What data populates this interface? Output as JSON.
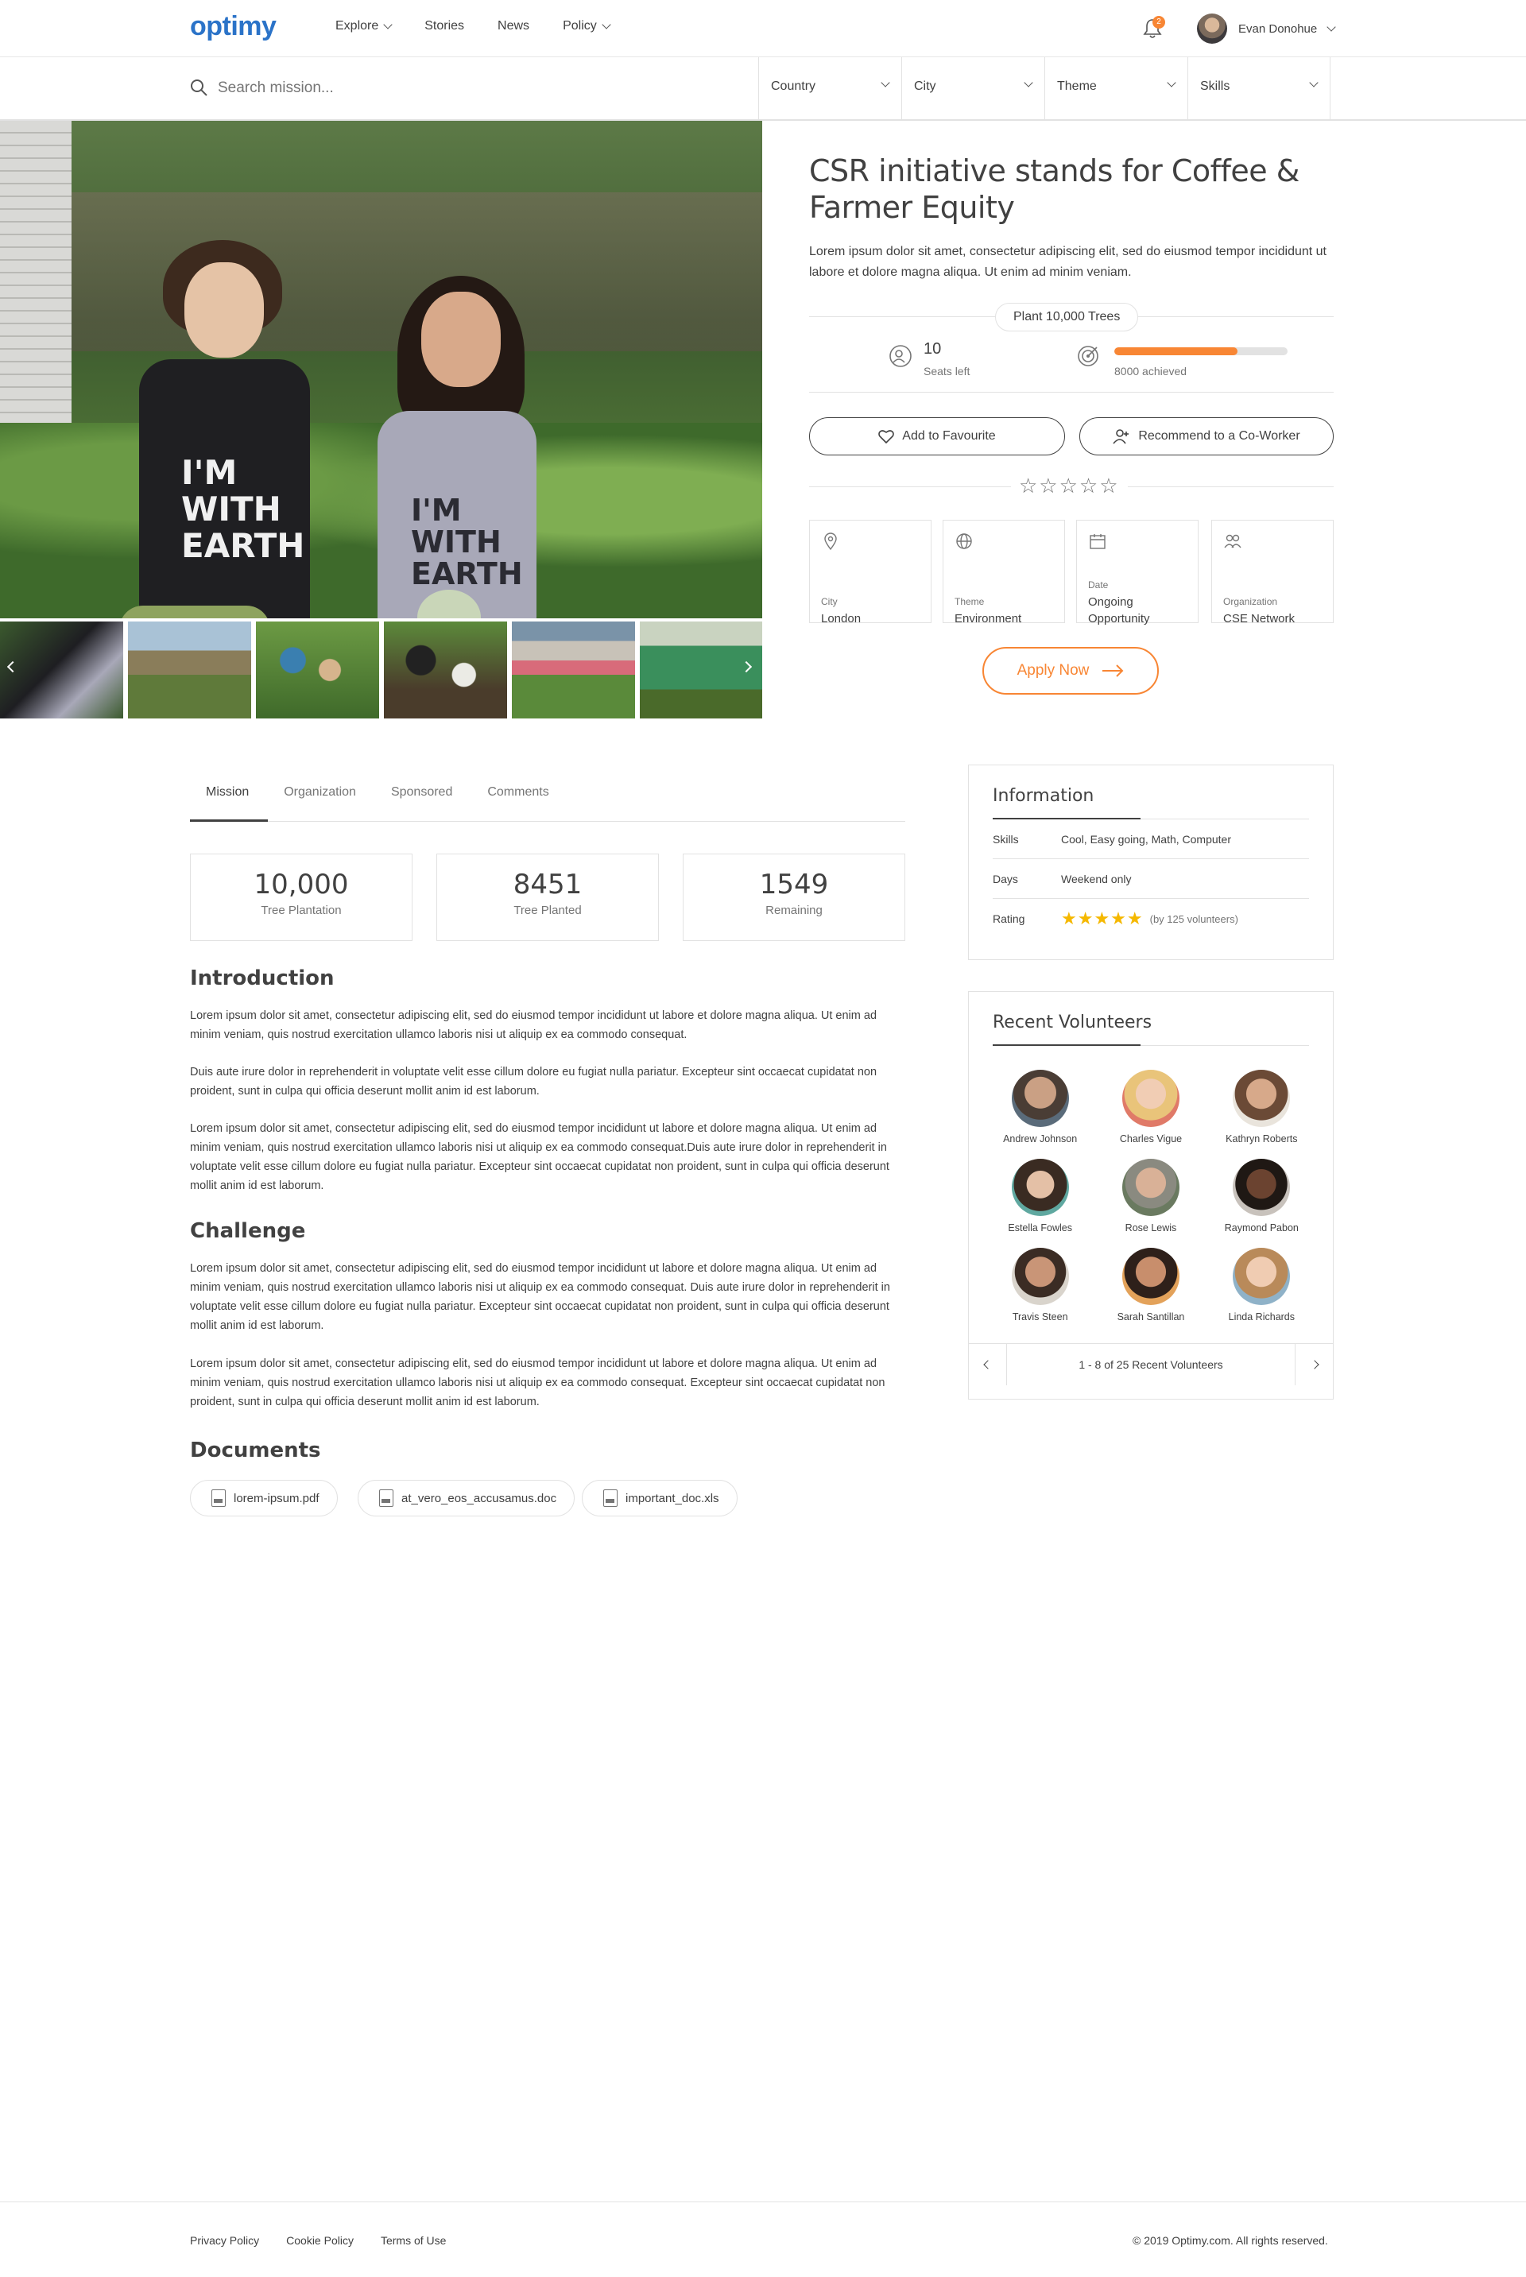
{
  "header": {
    "logo": "optimy",
    "nav": [
      "Explore",
      "Stories",
      "News",
      "Policy"
    ],
    "notification_count": "2",
    "user_name": "Evan Donohue"
  },
  "search": {
    "placeholder": "Search mission...",
    "filters": [
      "Country",
      "City",
      "Theme",
      "Skills"
    ]
  },
  "mission": {
    "title": "CSR initiative stands for Coffee & Farmer Equity",
    "description": "Lorem ipsum dolor sit amet, consectetur adipiscing elit, sed do eiusmod tempor incididunt ut labore et dolore magna aliqua. Ut enim ad minim veniam.",
    "goal": "Plant 10,000 Trees",
    "seats_left": "10",
    "seats_label": "Seats left",
    "progress": 0.71,
    "achieved_label": "8000 achieved",
    "favourite_label": "Add to Favourite",
    "recommend_label": "Recommend to a Co-Worker",
    "rating_stars": "☆☆☆☆☆",
    "details": [
      {
        "label": "City",
        "value": "London"
      },
      {
        "label": "Theme",
        "value": "Environment"
      },
      {
        "label": "Date",
        "value": "Ongoing Opportunity"
      },
      {
        "label": "Organization",
        "value": "CSE Network"
      }
    ],
    "apply_label": "Apply Now"
  },
  "hero": {
    "shirt_text_1": "I'M WITH EARTH",
    "shirt_text_2": "I'M WITH EARTH"
  },
  "tabs": [
    "Mission",
    "Organization",
    "Sponsored",
    "Comments"
  ],
  "stats": [
    {
      "value": "10,000",
      "label": "Tree Plantation"
    },
    {
      "value": "8451",
      "label": "Tree Planted"
    },
    {
      "value": "1549",
      "label": "Remaining"
    }
  ],
  "content": {
    "intro_title": "Introduction",
    "intro_p1": "Lorem ipsum dolor sit amet, consectetur adipiscing elit, sed do eiusmod tempor incididunt ut labore et dolore magna aliqua. Ut enim ad minim veniam, quis nostrud exercitation ullamco laboris nisi ut aliquip ex ea commodo consequat.",
    "intro_p2": "Duis aute irure dolor in reprehenderit in voluptate velit esse cillum dolore eu fugiat nulla pariatur. Excepteur sint occaecat cupidatat non proident, sunt in culpa qui officia deserunt mollit anim id est laborum.",
    "intro_p3": "Lorem ipsum dolor sit amet, consectetur adipiscing elit, sed do eiusmod tempor incididunt ut labore et dolore magna aliqua. Ut enim ad minim veniam, quis nostrud exercitation ullamco laboris nisi ut aliquip ex ea commodo consequat.Duis aute irure dolor in reprehenderit in voluptate velit esse cillum dolore eu fugiat nulla pariatur. Excepteur sint occaecat cupidatat non proident, sunt in culpa qui officia deserunt mollit anim id est laborum.",
    "challenge_title": "Challenge",
    "challenge_p1": "Lorem ipsum dolor sit amet, consectetur adipiscing elit, sed do eiusmod tempor incididunt ut labore et dolore magna aliqua. Ut enim ad minim veniam, quis nostrud exercitation ullamco laboris nisi ut aliquip ex ea commodo consequat. Duis aute irure dolor in reprehenderit in voluptate velit esse cillum dolore eu fugiat nulla pariatur. Excepteur sint occaecat cupidatat non proident, sunt in culpa qui officia deserunt mollit anim id est laborum.",
    "challenge_p2": "Lorem ipsum dolor sit amet, consectetur adipiscing elit, sed do eiusmod tempor incididunt ut labore et dolore magna aliqua. Ut enim ad minim veniam, quis nostrud exercitation ullamco laboris nisi ut aliquip ex ea commodo consequat. Excepteur sint occaecat cupidatat non proident, sunt in culpa qui officia deserunt mollit anim id est laborum.",
    "documents_title": "Documents",
    "documents": [
      "lorem-ipsum.pdf",
      "at_vero_eos_accusamus.doc",
      "important_doc.xls"
    ]
  },
  "information": {
    "title": "Information",
    "rows": [
      {
        "key": "Skills",
        "value": "Cool, Easy going, Math, Computer"
      },
      {
        "key": "Days",
        "value": "Weekend only"
      },
      {
        "key": "Rating",
        "value": "(by 125 volunteers)"
      }
    ],
    "rating_stars": "★★★★★"
  },
  "volunteers": {
    "title": "Recent Volunteers",
    "names": [
      "Andrew Johnson",
      "Charles Vigue",
      "Kathryn Roberts",
      "Estella Fowles",
      "Rose Lewis",
      "Raymond Pabon",
      "Travis Steen",
      "Sarah Santillan",
      "Linda Richards"
    ],
    "pager": "1 - 8 of 25 Recent Volunteers"
  },
  "footer": {
    "links": [
      "Privacy Policy",
      "Cookie Policy",
      "Terms of Use"
    ],
    "copyright": "© 2019 Optimy.com. All rights reserved."
  },
  "colors": {
    "accent": "#f88634",
    "brand": "#2b73c8",
    "star": "#f5b800",
    "text": "#414141",
    "muted": "#757575",
    "border": "#e2e2e2"
  }
}
